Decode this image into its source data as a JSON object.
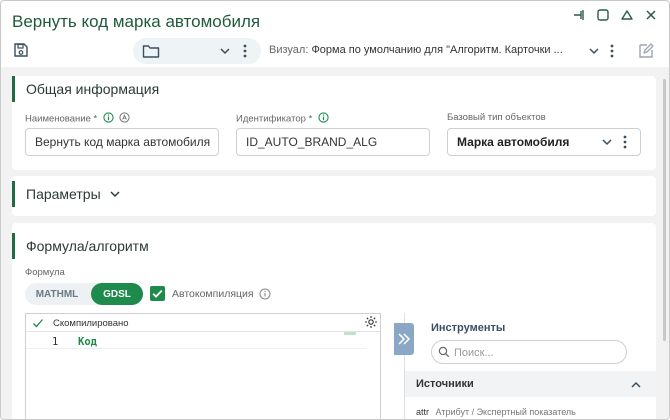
{
  "window": {
    "title": "Вернуть код марка автомобиля"
  },
  "toolbar": {
    "folder_value": "",
    "visual_label": "Визуал:",
    "visual_value": "Форма по умолчанию для \"Алгоритм. Карточки ..."
  },
  "general": {
    "title": "Общая информация",
    "name_label": "Наименование *",
    "name_value": "Вернуть код марка автомобиля",
    "id_label": "Идентификатор *",
    "id_value": "ID_AUTO_BRAND_ALG",
    "base_type_label": "Базовый тип объектов",
    "base_type_value": "Марка автомобиля"
  },
  "params": {
    "title": "Параметры"
  },
  "formula": {
    "title": "Формула/алгоритм",
    "label": "Формула",
    "mode_options": [
      "MATHML",
      "GDSL"
    ],
    "selected_mode": "GDSL",
    "autocompile_label": "Автокомпиляция",
    "autocompile_checked": true
  },
  "editor": {
    "status": "Скомпилировано",
    "lines": [
      {
        "num": "1",
        "code": "Код"
      }
    ]
  },
  "tools": {
    "title": "Инструменты",
    "search_placeholder": "Поиск...",
    "sources_title": "Источники",
    "sources_row_key": "attr",
    "sources_row_desc": "Атрибут / Экспертный показатель"
  },
  "colors": {
    "accent": "#1e8b4d",
    "title_color": "#1f5a3c",
    "panel_bar": "#1f6b43"
  }
}
